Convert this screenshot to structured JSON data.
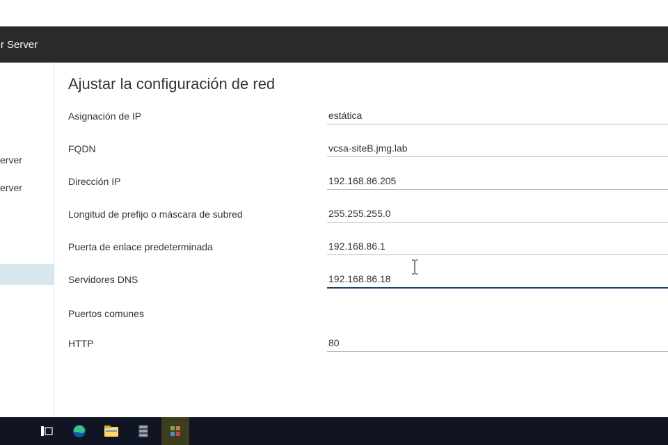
{
  "header": {
    "title": "nter Server"
  },
  "sidebar": {
    "items": [
      {
        "label": "erver"
      },
      {
        "label": "erver"
      }
    ]
  },
  "page": {
    "title": "Ajustar la configuración de red"
  },
  "form": {
    "ip_assignment": {
      "label": "Asignación de IP",
      "value": "estática"
    },
    "fqdn": {
      "label": "FQDN",
      "value": "vcsa-siteB.jmg.lab"
    },
    "ip_address": {
      "label": "Dirección IP",
      "value": "192.168.86.205"
    },
    "prefix": {
      "label": "Longitud de prefijo o máscara de subred",
      "value": "255.255.255.0"
    },
    "gateway": {
      "label": "Puerta de enlace predeterminada",
      "value": "192.168.86.1"
    },
    "dns": {
      "label": "Servidores DNS",
      "value": "192.168.86.18"
    },
    "ports_header": "Puertos comunes",
    "http": {
      "label": "HTTP",
      "value": "80"
    }
  }
}
